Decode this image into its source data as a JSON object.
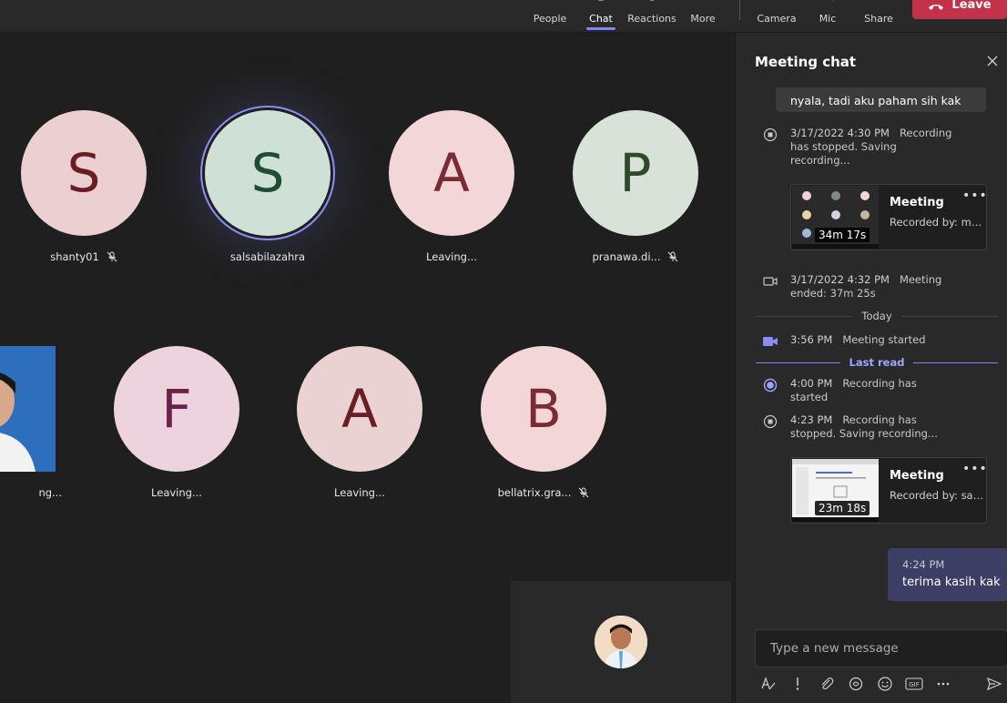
{
  "topbar": {
    "people_label": "People",
    "chat_label": "Chat",
    "reactions_label": "Reactions",
    "more_label": "More",
    "camera_label": "Camera",
    "mic_label": "Mic",
    "share_label": "Share",
    "leave_label": "Leave",
    "accent_color": "#7f85f5",
    "leave_color": "#c4314b"
  },
  "participants": [
    {
      "initial": "S",
      "name": "shanty01",
      "bg": "#ecd0d1",
      "fg": "#6b1d24",
      "muted": true
    },
    {
      "initial": "S",
      "name": "salsabilazahra",
      "bg": "#cfe1d6",
      "fg": "#1f4d33",
      "muted": false,
      "speaking": true
    },
    {
      "initial": "A",
      "name": "Leaving...",
      "bg": "#f3d6d8",
      "fg": "#7a2b35",
      "muted": false
    },
    {
      "initial": "P",
      "name": "pranawa.di...",
      "bg": "#d9e2d9",
      "fg": "#2e4a2a",
      "muted": true
    },
    {
      "initial": "",
      "name": "ng...",
      "photo": true
    },
    {
      "initial": "F",
      "name": "Leaving...",
      "bg": "#ecd3de",
      "fg": "#6a2249",
      "muted": false
    },
    {
      "initial": "A",
      "name": "Leaving...",
      "bg": "#ebd2d2",
      "fg": "#6a1d22",
      "muted": false
    },
    {
      "initial": "B",
      "name": "bellatrix.gra...",
      "bg": "#f3d7d8",
      "fg": "#7a2b35",
      "muted": true
    }
  ],
  "chat": {
    "title": "Meeting chat",
    "top_message": "nyala, tadi aku paham sih kak",
    "events": [
      {
        "time": "3/17/2022 4:30 PM",
        "text": "Recording has stopped. Saving recording...",
        "icon": "stop-record-icon"
      },
      {
        "time": "3/17/2022 4:32 PM",
        "text": "Meeting ended: 37m 25s",
        "icon": "video-camera-icon"
      },
      {
        "time": "3:56 PM",
        "text": "Meeting started",
        "icon": "video-camera-filled-icon"
      },
      {
        "time": "4:00 PM",
        "text": "Recording has started",
        "icon": "record-icon"
      },
      {
        "time": "4:23 PM",
        "text": "Recording has stopped. Saving recording...",
        "icon": "stop-record-icon"
      }
    ],
    "recordings": [
      {
        "title": "Meeting",
        "sub": "Recorded by: mu...",
        "duration": "34m 17s"
      },
      {
        "title": "Meeting",
        "sub": "Recorded by: sals...",
        "duration": "23m 18s"
      }
    ],
    "today_label": "Today",
    "last_read_label": "Last read",
    "my_message": {
      "time": "4:24 PM",
      "text": "terima kasih kak"
    },
    "composer_placeholder": "Type a new message"
  }
}
